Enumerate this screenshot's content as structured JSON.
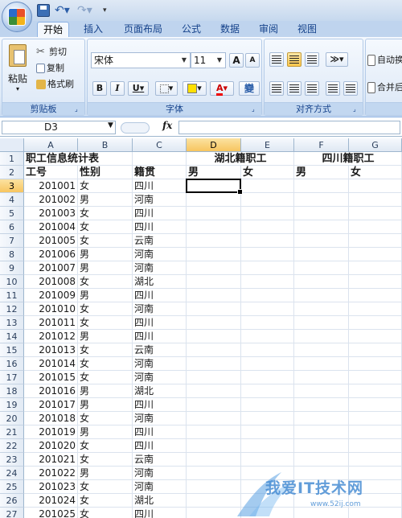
{
  "tabs": [
    "开始",
    "插入",
    "页面布局",
    "公式",
    "数据",
    "审阅",
    "视图"
  ],
  "active_tab": "开始",
  "ribbon": {
    "clipboard": {
      "paste": "粘贴",
      "cut": "剪切",
      "copy": "复制",
      "format_painter": "格式刷",
      "label": "剪贴板"
    },
    "font": {
      "name": "宋体",
      "size": "11",
      "grow": "A",
      "shrink": "A",
      "bold": "B",
      "italic": "I",
      "underline": "U",
      "wen": "變",
      "label": "字体"
    },
    "alignment": {
      "label": "对齐方式",
      "wrap": "自动换",
      "merge": "合并后"
    }
  },
  "formula_bar": {
    "name_box": "D3",
    "fx": "fx",
    "content": ""
  },
  "columns": [
    "A",
    "B",
    "C",
    "D",
    "E",
    "F",
    "G"
  ],
  "selected_column": "D",
  "selected_row": "3",
  "rows": [
    {
      "n": "1",
      "a": "职工信息统计表",
      "b": "",
      "c": "",
      "d": "",
      "e": "",
      "f": "",
      "g": ""
    },
    {
      "n": "2",
      "a": "工号",
      "b": "性别",
      "c": "籍贯",
      "d": "男",
      "e": "女",
      "f": "男",
      "g": "女"
    },
    {
      "n": "3",
      "a": "201001",
      "b": "女",
      "c": "四川"
    },
    {
      "n": "4",
      "a": "201002",
      "b": "男",
      "c": "河南"
    },
    {
      "n": "5",
      "a": "201003",
      "b": "女",
      "c": "四川"
    },
    {
      "n": "6",
      "a": "201004",
      "b": "女",
      "c": "四川"
    },
    {
      "n": "7",
      "a": "201005",
      "b": "女",
      "c": "云南"
    },
    {
      "n": "8",
      "a": "201006",
      "b": "男",
      "c": "河南"
    },
    {
      "n": "9",
      "a": "201007",
      "b": "男",
      "c": "河南"
    },
    {
      "n": "10",
      "a": "201008",
      "b": "女",
      "c": "湖北"
    },
    {
      "n": "11",
      "a": "201009",
      "b": "男",
      "c": "四川"
    },
    {
      "n": "12",
      "a": "201010",
      "b": "女",
      "c": "河南"
    },
    {
      "n": "13",
      "a": "201011",
      "b": "女",
      "c": "四川"
    },
    {
      "n": "14",
      "a": "201012",
      "b": "男",
      "c": "四川"
    },
    {
      "n": "15",
      "a": "201013",
      "b": "女",
      "c": "云南"
    },
    {
      "n": "16",
      "a": "201014",
      "b": "女",
      "c": "河南"
    },
    {
      "n": "17",
      "a": "201015",
      "b": "女",
      "c": "河南"
    },
    {
      "n": "18",
      "a": "201016",
      "b": "男",
      "c": "湖北"
    },
    {
      "n": "19",
      "a": "201017",
      "b": "男",
      "c": "四川"
    },
    {
      "n": "20",
      "a": "201018",
      "b": "女",
      "c": "河南"
    },
    {
      "n": "21",
      "a": "201019",
      "b": "男",
      "c": "四川"
    },
    {
      "n": "22",
      "a": "201020",
      "b": "女",
      "c": "四川"
    },
    {
      "n": "23",
      "a": "201021",
      "b": "女",
      "c": "云南"
    },
    {
      "n": "24",
      "a": "201022",
      "b": "男",
      "c": "河南"
    },
    {
      "n": "25",
      "a": "201023",
      "b": "女",
      "c": "河南"
    },
    {
      "n": "26",
      "a": "201024",
      "b": "女",
      "c": "湖北"
    },
    {
      "n": "27",
      "a": "201025",
      "b": "女",
      "c": "四川"
    }
  ],
  "merged_headers": {
    "hubei": "湖北籍职工",
    "sichuan": "四川籍职工"
  },
  "watermark": {
    "text": "我爱IT技术网",
    "url": "www.52ij.com"
  }
}
